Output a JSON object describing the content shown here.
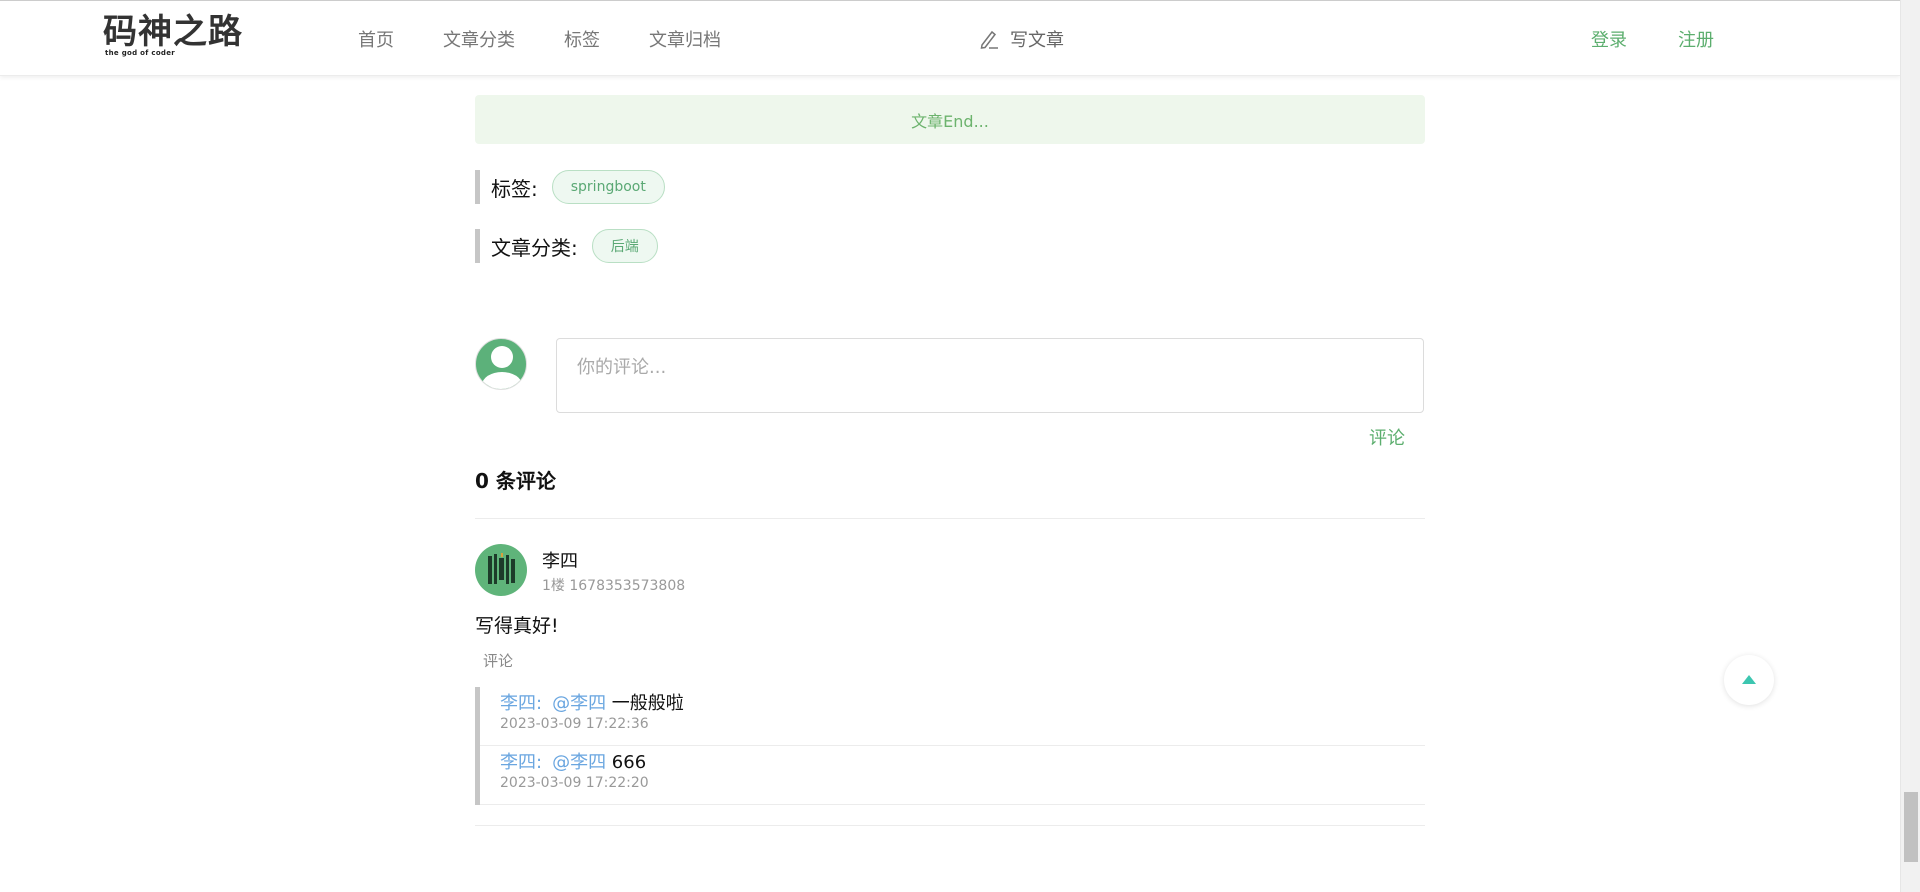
{
  "header": {
    "logo_text": "码神之路",
    "logo_sub": "the god of coder",
    "nav": [
      "首页",
      "文章分类",
      "标签",
      "文章归档"
    ],
    "write_label": "写文章",
    "login_label": "登录",
    "register_label": "注册"
  },
  "article": {
    "end_text": "文章End...",
    "tags_label": "标签:",
    "tags": [
      "springboot"
    ],
    "category_label": "文章分类:",
    "category": "后端"
  },
  "comment_form": {
    "placeholder": "你的评论...",
    "submit_label": "评论"
  },
  "comments": {
    "count_title": "0 条评论",
    "items": [
      {
        "author": "李四",
        "floor": "1楼 1678353573808",
        "content": "写得真好!",
        "reply_label": "评论",
        "replies": [
          {
            "author": "李四:",
            "target": "@李四",
            "content": " 一般般啦",
            "time": "2023-03-09 17:22:36"
          },
          {
            "author": "李四:",
            "target": "@李四",
            "content": " 666",
            "time": "2023-03-09 17:22:20"
          }
        ]
      }
    ]
  },
  "colors": {
    "accent": "#5cae6e",
    "link_blue": "#6aa6e0",
    "end_bg": "#eef7ec"
  }
}
